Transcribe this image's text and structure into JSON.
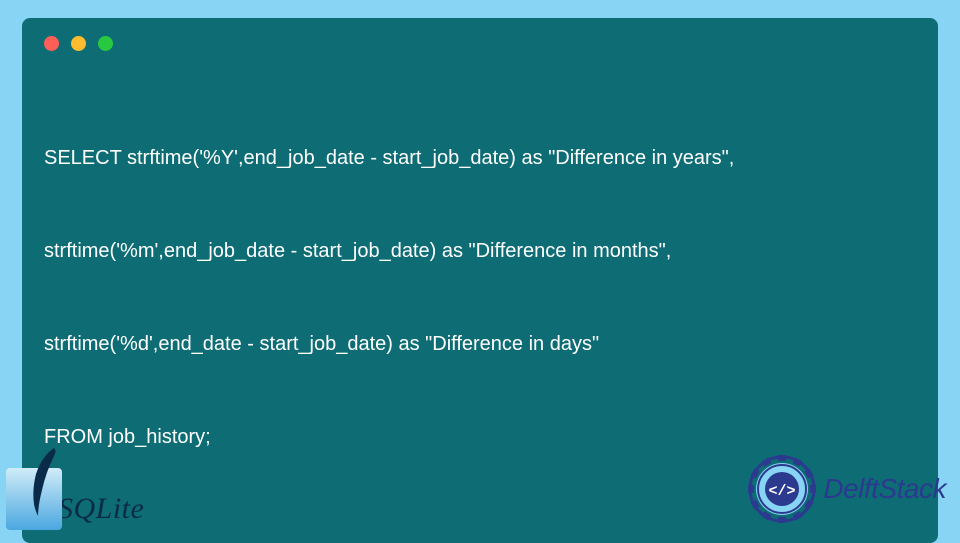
{
  "code": {
    "line1": "SELECT strftime('%Y',end_job_date - start_job_date) as \"Difference in years\",",
    "line2": "strftime('%m',end_job_date - start_job_date) as \"Difference in months\",",
    "line3": "strftime('%d',end_date - start_job_date) as \"Difference in days\"",
    "line4": "FROM job_history;"
  },
  "brands": {
    "sqlite": "SQLite",
    "delftstack": "DelftStack"
  },
  "colors": {
    "background": "#87d4f4",
    "panel": "#0d6c74",
    "codeText": "#ffffff",
    "delftBlue": "#2b3a8f"
  }
}
